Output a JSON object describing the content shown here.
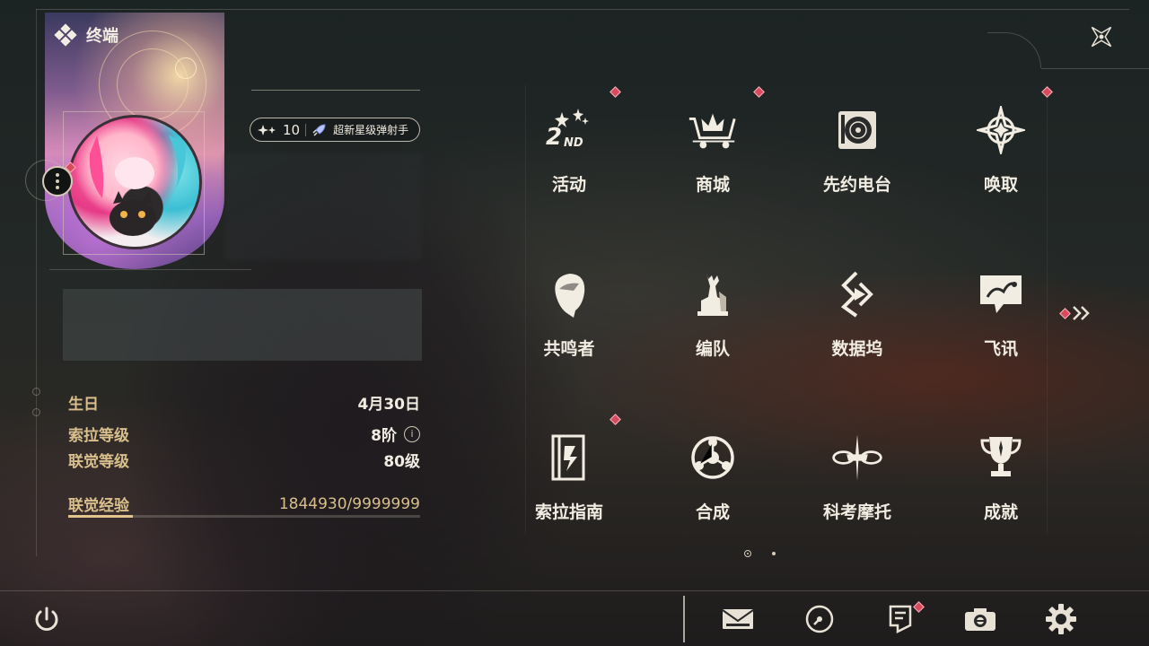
{
  "header": {
    "title": "终端",
    "title_icon": "diamond-cluster-icon",
    "close_icon": "close-star-icon"
  },
  "profile": {
    "avatar": "character-avatar",
    "badge": {
      "count": "10",
      "icon": "rocket-icon",
      "title": "超新星级弹射手"
    }
  },
  "stats": {
    "birthday": {
      "label": "生日",
      "value": "4月30日"
    },
    "sola_level": {
      "label": "索拉等级",
      "value": "8阶",
      "info_icon": "i"
    },
    "union_level": {
      "label": "联觉等级",
      "value": "80级"
    },
    "union_exp": {
      "label": "联觉经验",
      "value": "1844930/9999999",
      "progress": 0.1845
    }
  },
  "menu": {
    "items": [
      {
        "label": "活动",
        "icon": "2nd-anniversary-icon",
        "alert": true
      },
      {
        "label": "商城",
        "icon": "shop-cart-icon",
        "alert": true
      },
      {
        "label": "先约电台",
        "icon": "radio-vinyl-icon",
        "alert": false
      },
      {
        "label": "唤取",
        "icon": "convene-star-icon",
        "alert": true
      },
      {
        "label": "共鸣者",
        "icon": "resonator-head-icon",
        "alert": false
      },
      {
        "label": "编队",
        "icon": "chess-team-icon",
        "alert": false
      },
      {
        "label": "数据坞",
        "icon": "data-dock-icon",
        "alert": false
      },
      {
        "label": "飞讯",
        "icon": "chat-message-icon",
        "alert": false
      },
      {
        "label": "索拉指南",
        "icon": "guide-book-icon",
        "alert": true
      },
      {
        "label": "合成",
        "icon": "synthesis-icon",
        "alert": false
      },
      {
        "label": "科考摩托",
        "icon": "motorbike-icon",
        "alert": false
      },
      {
        "label": "成就",
        "icon": "trophy-icon",
        "alert": false
      }
    ],
    "page_count": 2,
    "current_page": 1
  },
  "bottom_bar": {
    "power_icon": "power-icon",
    "buttons": [
      {
        "icon": "mail-icon",
        "alert": false
      },
      {
        "icon": "clock-icon",
        "alert": false
      },
      {
        "icon": "notice-icon",
        "alert": true
      },
      {
        "icon": "camera-icon",
        "alert": false
      },
      {
        "icon": "settings-gear-icon",
        "alert": false
      }
    ]
  },
  "colors": {
    "accent_gold": "#d9bf8c",
    "alert_red": "#d94a5c",
    "text_light": "#f2ede2"
  }
}
